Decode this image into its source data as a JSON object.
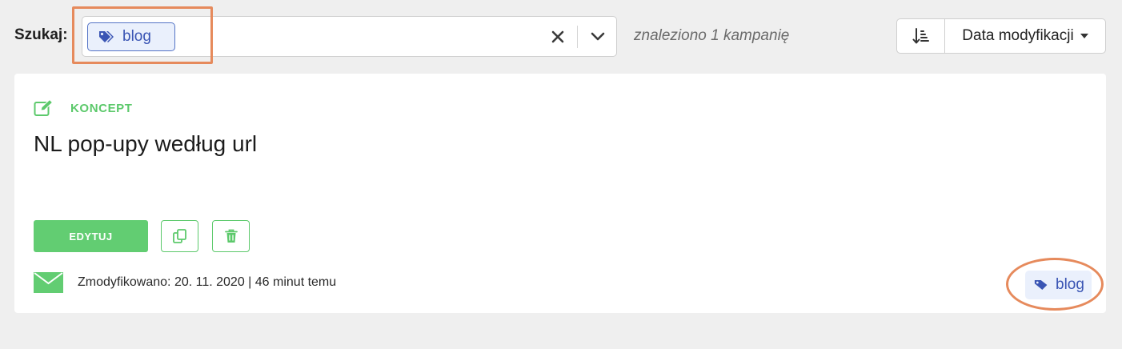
{
  "search": {
    "label": "Szukaj:",
    "tag": "blog",
    "tag_icon": "tag-icon",
    "clear_icon": "close-icon",
    "dropdown_icon": "chevron-down-icon"
  },
  "result_count": "znaleziono 1 kampanię",
  "sort": {
    "direction_icon": "sort-descending-icon",
    "field": "Data modyfikacji",
    "field_icon": "caret-down-icon"
  },
  "campaign": {
    "status": "KONCEPT",
    "status_icon": "pencil-square-icon",
    "title": "NL pop-upy według url",
    "edit_label": "EDYTUJ",
    "copy_icon": "copy-icon",
    "delete_icon": "trash-icon",
    "type_icon": "envelope-icon",
    "modified": "Zmodyfikowano: 20. 11. 2020  |  46 minut temu",
    "tag": "blog"
  },
  "colors": {
    "accent_green": "#5cc96b",
    "tag_blue": "#3a55b4",
    "tag_bg": "#eaf0fc",
    "highlight_orange": "#e68a5c"
  }
}
